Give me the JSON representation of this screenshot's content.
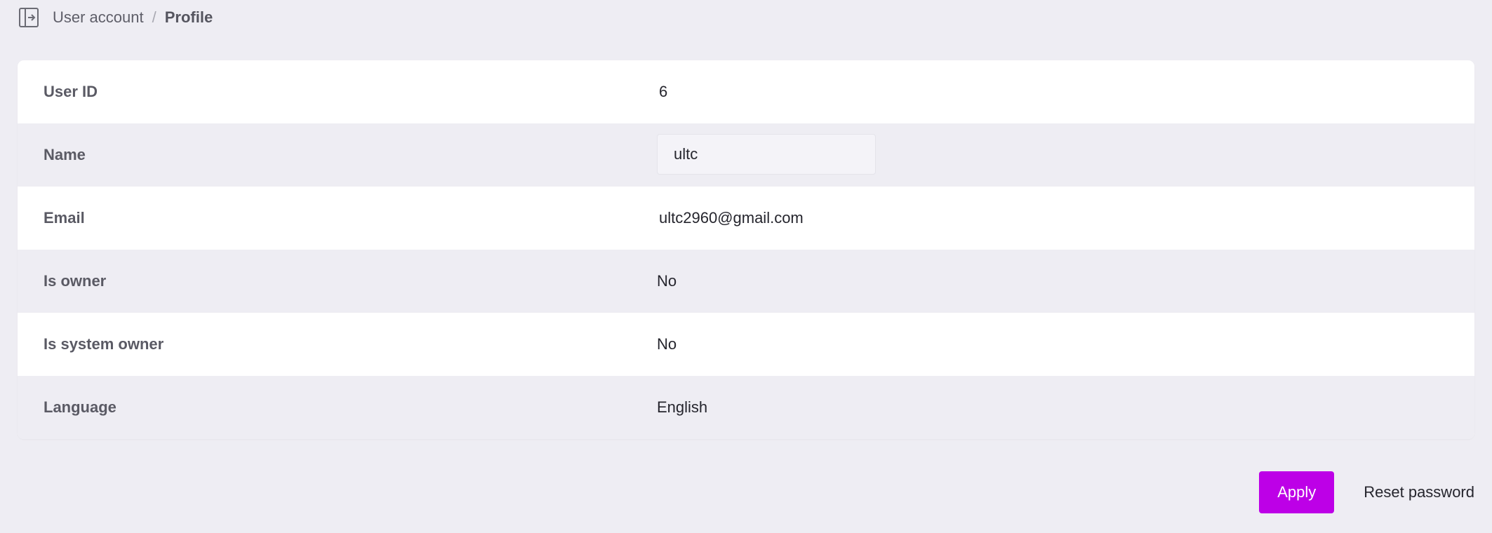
{
  "header": {
    "toggle_icon": "sidebar-toggle-icon",
    "breadcrumb": {
      "parent": "User account",
      "separator": "/",
      "current": "Profile"
    }
  },
  "profile": {
    "user_id": {
      "label": "User ID",
      "value": "6"
    },
    "name": {
      "label": "Name",
      "value": "ultc"
    },
    "email": {
      "label": "Email",
      "value": "ultc2960@gmail.com"
    },
    "is_owner": {
      "label": "Is owner",
      "value": "No"
    },
    "is_system_owner": {
      "label": "Is system owner",
      "value": "No"
    },
    "language": {
      "label": "Language",
      "value": "English"
    }
  },
  "actions": {
    "apply_label": "Apply",
    "reset_password_label": "Reset password"
  },
  "colors": {
    "background": "#eeedf3",
    "card": "#ffffff",
    "accent": "#bd00e7"
  }
}
